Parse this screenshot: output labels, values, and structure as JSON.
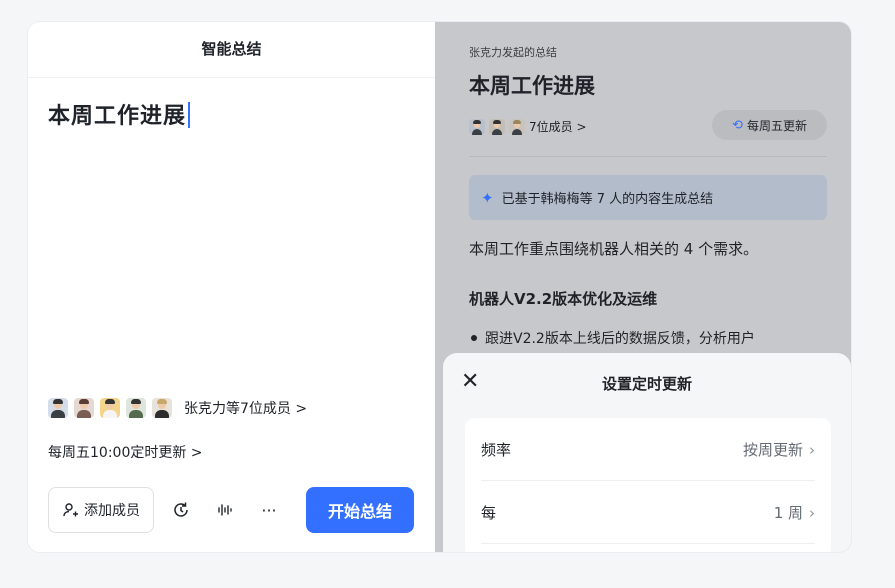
{
  "left_panel": {
    "header": "智能总结",
    "title": "本周工作进展",
    "members_text": "张克力等7位成员 >",
    "schedule_text": "每周五10:00定时更新 >",
    "toolbar": {
      "add_member_label": "添加成员",
      "more_label": "···",
      "start_label": "开始总结"
    }
  },
  "right_panel": {
    "initiator": "张克力发起的总结",
    "title": "本周工作进展",
    "members_text": "7位成员 >",
    "weekly_pill": "每周五更新",
    "ai_banner": "已基于韩梅梅等 7 人的内容生成总结",
    "summary": "本周工作重点围绕机器人相关的 4 个需求。",
    "section_heading": "机器人V2.2版本优化及运维",
    "bullet_1": "跟进V2.2版本上线后的数据反馈，分析用户"
  },
  "sheet": {
    "title": "设置定时更新",
    "rows": [
      {
        "label": "频率",
        "value": "按周更新"
      },
      {
        "label": "每",
        "value": "1 周"
      }
    ]
  },
  "colors": {
    "accent": "#3370ff",
    "overlay": "#c7c8cb"
  },
  "icons": [
    "avatar",
    "add-person-icon",
    "clock-refresh-icon",
    "voice-wave-icon",
    "more-icon",
    "sparkle-icon",
    "close-icon",
    "chevron-right-icon"
  ]
}
